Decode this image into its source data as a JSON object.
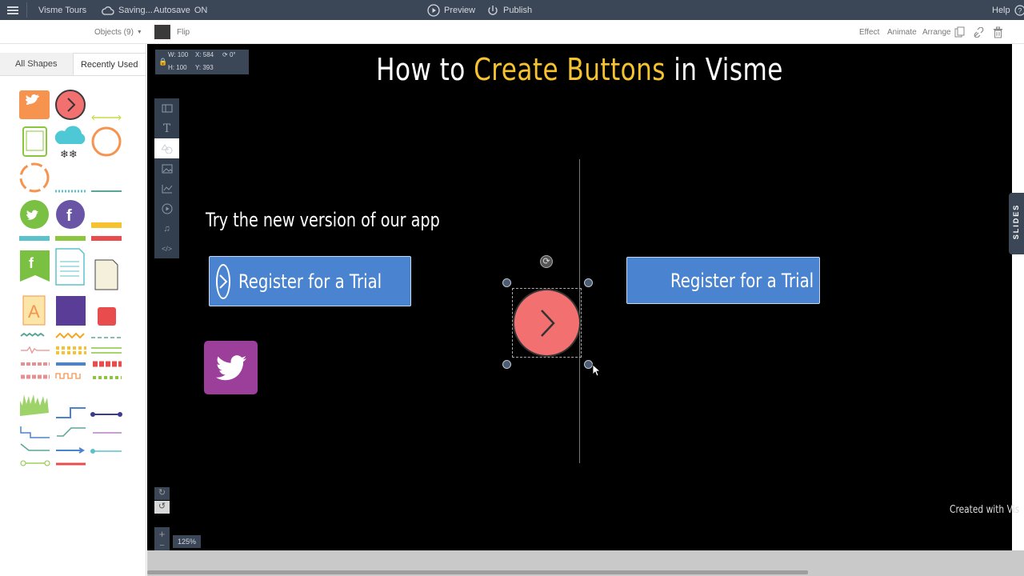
{
  "topbar": {
    "menu_icon": "hamburger-icon",
    "project": "Visme Tours",
    "saving": "Saving...",
    "autosave_label": "Autosave",
    "autosave_state": "ON",
    "preview": "Preview",
    "publish": "Publish",
    "help": "Help"
  },
  "subtoolbar": {
    "objects": "Objects (9)",
    "flip": "Flip",
    "effect": "Effect",
    "animate": "Animate",
    "arrange": "Arrange"
  },
  "panel": {
    "tabs": [
      "All Shapes",
      "Recently Used"
    ],
    "active_tab": "Recently Used"
  },
  "canvas": {
    "dims": {
      "w": "W: 100",
      "h": "H: 100",
      "x": "X: 584",
      "y": "Y: 393",
      "rot": "0°"
    },
    "title_part1": "How to ",
    "title_highlight": "Create Buttons",
    "title_part2": " in Visme",
    "tagline": "Try the new version of our app",
    "button1": "Register for a Trial",
    "button2": "Register for a Trial",
    "watermark": "Created with Vis",
    "zoom": "125%",
    "slides_tab": "SLIDES"
  },
  "colors": {
    "topbar": "#3b4656",
    "accent_yellow": "#f7c22f",
    "button_blue": "#4a84d0",
    "coral": "#f2706f",
    "purple": "#9b3f9a"
  }
}
